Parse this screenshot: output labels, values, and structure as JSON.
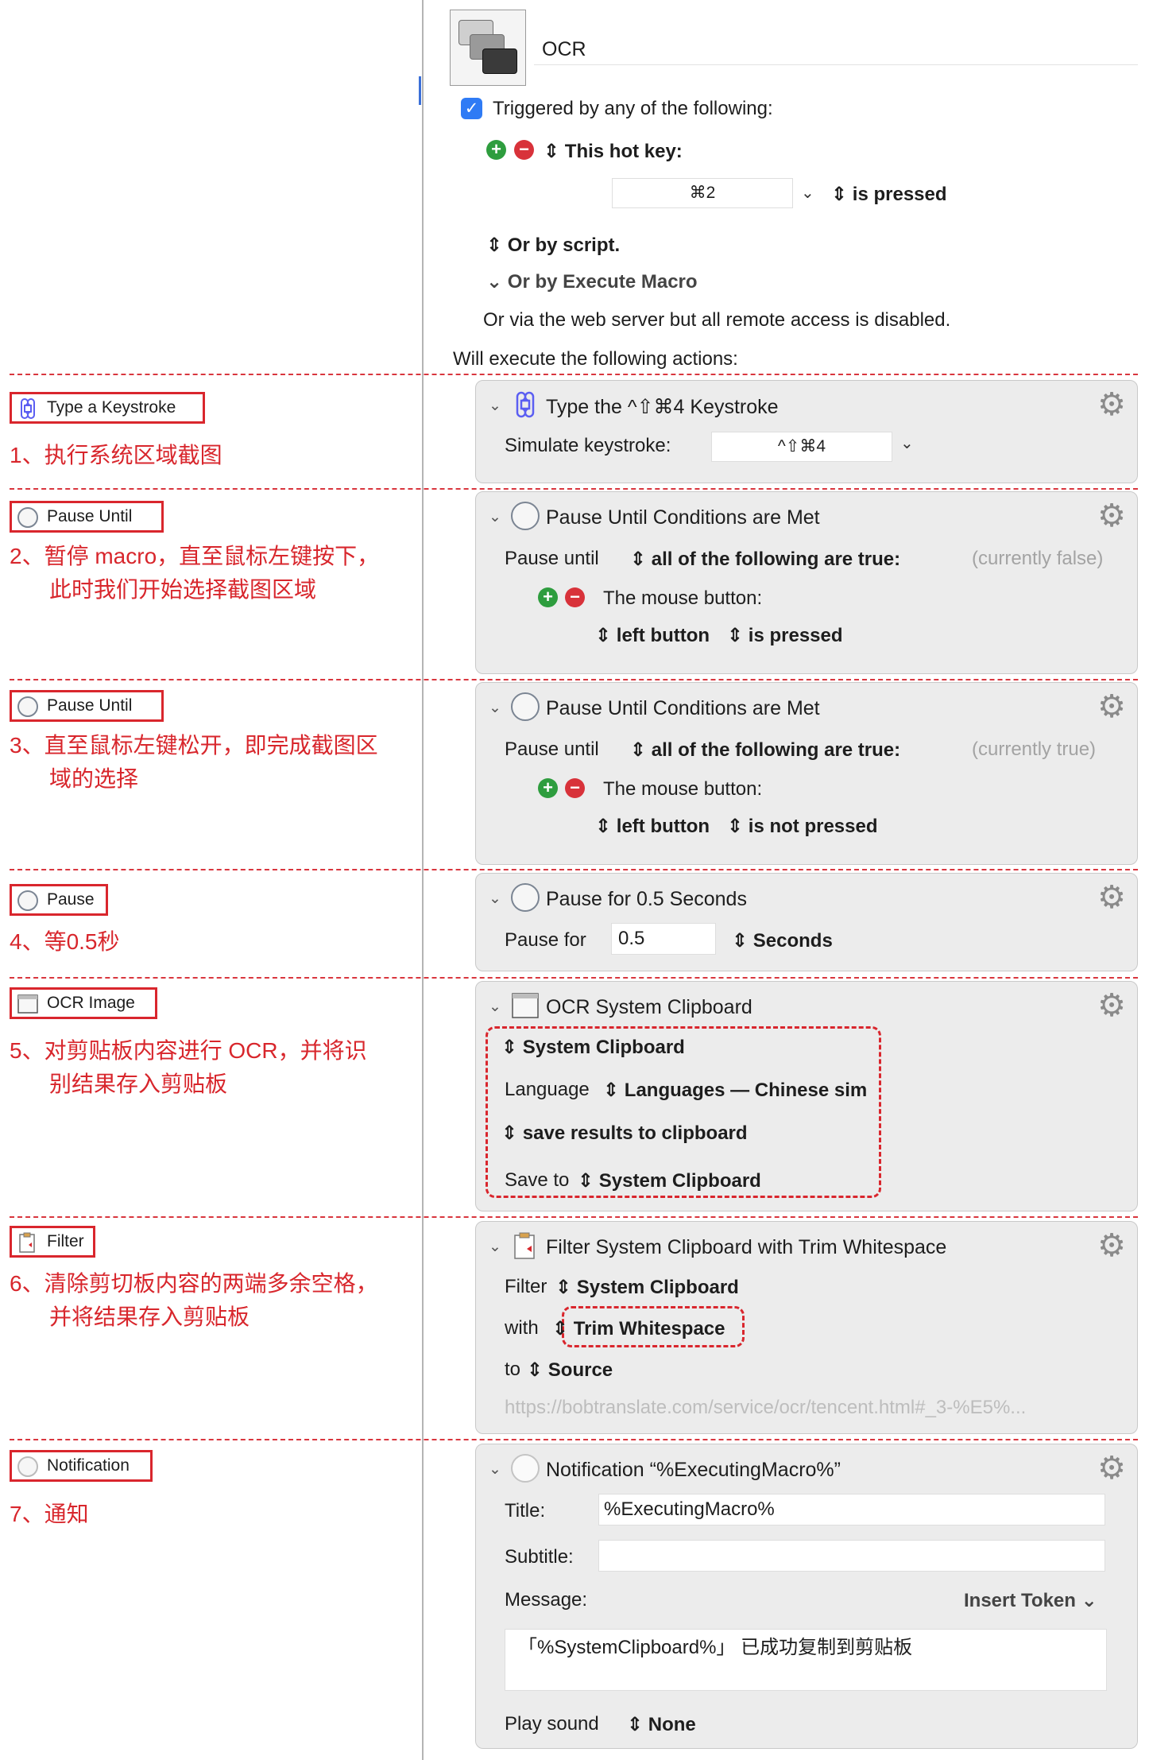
{
  "macro": {
    "name": "OCR",
    "trigger_label": "Triggered by any of the following:",
    "hotkey_label": "This hot key:",
    "hotkey_value": "⌘2",
    "hotkey_state": "is pressed",
    "or_script": "Or by script.",
    "or_execute": "Or by Execute Macro",
    "web_server_note": "Or via the web server but all remote access is disabled.",
    "will_execute": "Will execute the following actions:"
  },
  "callouts": [
    {
      "label": "Type a Keystroke",
      "icon": "command-icon",
      "text_lines": [
        "1、执行系统区域截图"
      ]
    },
    {
      "label": "Pause Until",
      "icon": "clock-icon",
      "text_lines": [
        "2、暂停 macro，直至鼠标左键按下，",
        "此时我们开始选择截图区域"
      ]
    },
    {
      "label": "Pause Until",
      "icon": "clock-icon",
      "text_lines": [
        "3、直至鼠标左键松开，即完成截图区",
        "域的选择"
      ]
    },
    {
      "label": "Pause",
      "icon": "clock-icon",
      "text_lines": [
        "4、等0.5秒"
      ]
    },
    {
      "label": "OCR Image",
      "icon": "window-icon",
      "text_lines": [
        "5、对剪贴板内容进行 OCR，并将识",
        "别结果存入剪贴板"
      ]
    },
    {
      "label": "Filter",
      "icon": "clipboard-icon",
      "text_lines": [
        "6、清除剪切板内容的两端多余空格，",
        "并将结果存入剪贴板"
      ]
    },
    {
      "label": "Notification",
      "icon": "bell-icon",
      "text_lines": [
        "7、通知"
      ]
    }
  ],
  "actions": {
    "keystroke": {
      "title": "Type the ^⇧⌘4 Keystroke",
      "simulate_label": "Simulate keystroke:",
      "value": "^⇧⌘4"
    },
    "pause_until_1": {
      "title": "Pause Until Conditions are Met",
      "pause_label": "Pause until",
      "condition": "all of the following are true:",
      "status": "(currently false)",
      "mouse_label": "The mouse button:",
      "button": "left button",
      "state": "is pressed"
    },
    "pause_until_2": {
      "title": "Pause Until Conditions are Met",
      "pause_label": "Pause until",
      "condition": "all of the following are true:",
      "status": "(currently true)",
      "mouse_label": "The mouse button:",
      "button": "left button",
      "state": "is not pressed"
    },
    "pause": {
      "title": "Pause for 0.5 Seconds",
      "label": "Pause for",
      "value": "0.5",
      "unit": "Seconds"
    },
    "ocr": {
      "title": "OCR System Clipboard",
      "source": "System Clipboard",
      "language_label": "Language",
      "language_value": "Languages — Chinese sim",
      "results": "save results to clipboard",
      "save_label": "Save to",
      "save_value": "System Clipboard"
    },
    "filter": {
      "title": "Filter System Clipboard with Trim Whitespace",
      "filter_label": "Filter",
      "filter_value": "System Clipboard",
      "with_label": "with",
      "with_value": "Trim Whitespace",
      "to_label": "to",
      "to_value": "Source",
      "url": "https://bobtranslate.com/service/ocr/tencent.html#_3-%E5%..."
    },
    "notification": {
      "title": "Notification “%ExecutingMacro%”",
      "title_label": "Title:",
      "title_value": "%ExecutingMacro%",
      "subtitle_label": "Subtitle:",
      "subtitle_value": "",
      "message_label": "Message:",
      "insert_token": "Insert Token",
      "message_value": "「%SystemClipboard%」 已成功复制到剪贴板",
      "sound_label": "Play sound",
      "sound_value": "None"
    }
  },
  "colors": {
    "accent_red": "#d8262c",
    "checkbox_blue": "#2f7bf5",
    "panel_bg": "#ececec"
  }
}
